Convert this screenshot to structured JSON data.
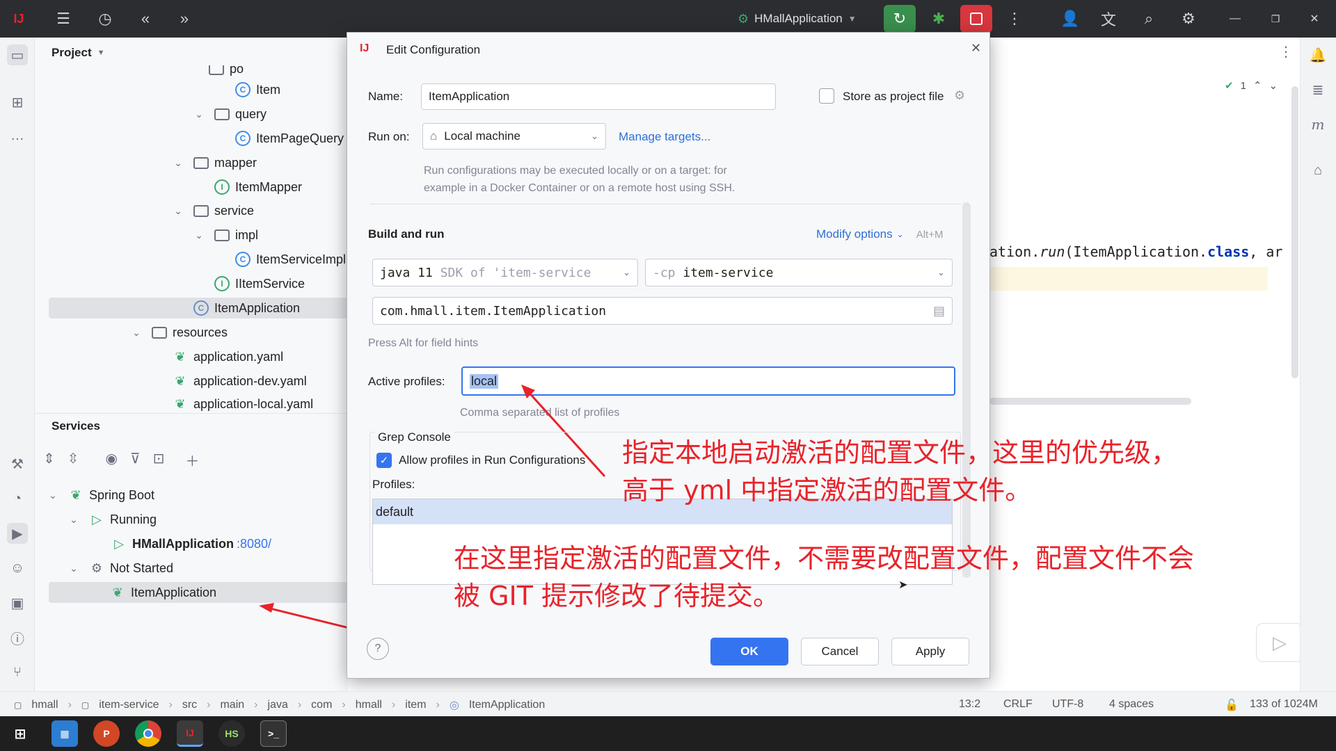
{
  "titlebar": {
    "run_config": "HMallApplication"
  },
  "project_panel": {
    "title": "Project",
    "tree": [
      {
        "label": "po",
        "kind": "folder"
      },
      {
        "label": "Item",
        "kind": "class"
      },
      {
        "label": "query",
        "kind": "folder"
      },
      {
        "label": "ItemPageQuery",
        "kind": "class"
      },
      {
        "label": "mapper",
        "kind": "folder"
      },
      {
        "label": "ItemMapper",
        "kind": "interface"
      },
      {
        "label": "service",
        "kind": "folder"
      },
      {
        "label": "impl",
        "kind": "folder"
      },
      {
        "label": "ItemServiceImpl",
        "kind": "class"
      },
      {
        "label": "IItemService",
        "kind": "interface"
      },
      {
        "label": "ItemApplication",
        "kind": "springclass"
      },
      {
        "label": "resources",
        "kind": "folder"
      },
      {
        "label": "application.yaml",
        "kind": "yaml"
      },
      {
        "label": "application-dev.yaml",
        "kind": "yaml"
      },
      {
        "label": "application-local.yaml",
        "kind": "yaml"
      }
    ]
  },
  "services_panel": {
    "title": "Services",
    "spring_boot": "Spring Boot",
    "running": "Running",
    "hmall_app": "HMallApplication",
    "hmall_port": ":8080/",
    "not_started": "Not Started",
    "item_app": "ItemApplication"
  },
  "editor": {
    "code_prefix": "ation.",
    "code_method": "run",
    "code_mid": "(ItemApplication.",
    "code_kw": "class",
    "code_tail": ", ar",
    "inspections_count": "1"
  },
  "dialog": {
    "title": "Edit Configuration",
    "name_label": "Name:",
    "name_value": "ItemApplication",
    "store_label": "Store as project file",
    "store_checked": false,
    "run_on_label": "Run on:",
    "run_on_value": "Local machine",
    "manage_targets": "Manage targets...",
    "run_on_hint_1": "Run configurations may be executed locally or on a target: for",
    "run_on_hint_2": "example in a Docker Container or on a remote host using SSH.",
    "build_run_heading": "Build and run",
    "modify_options": "Modify options",
    "modify_shortcut": "Alt+M",
    "sdk_prefix": "java 11",
    "sdk_suffix": "SDK of 'item-service",
    "cp_prefix": "-cp",
    "cp_value": "item-service",
    "main_class": "com.hmall.item.ItemApplication",
    "field_hint": "Press Alt for field hints",
    "active_profiles_label": "Active profiles:",
    "active_profiles_value": "local",
    "active_profiles_hint": "Comma separated list of profiles",
    "grep_console": "Grep Console",
    "allow_profiles": "Allow profiles in Run Configurations",
    "allow_profiles_checked": true,
    "profiles_label": "Profiles:",
    "profiles_item": "default",
    "ok": "OK",
    "cancel": "Cancel",
    "apply": "Apply"
  },
  "annotations": {
    "line1": "指定本地启动激活的配置文件，这里的优先级，",
    "line2": "高于 yml 中指定激活的配置文件。",
    "line3": "在这里指定激活的配置文件，不需要改配置文件，配置文件不会",
    "line4": "被 GIT 提示修改了待提交。"
  },
  "statusbar": {
    "breadcrumbs": [
      "hmall",
      "item-service",
      "src",
      "main",
      "java",
      "com",
      "hmall",
      "item",
      "ItemApplication"
    ],
    "position": "13:2",
    "line_sep": "CRLF",
    "encoding": "UTF-8",
    "indent": "4 spaces",
    "memory": "133 of 1024M"
  },
  "colors": {
    "accent": "#3574f0",
    "annotation": "#e8232a",
    "titlebar": "#2b2d30"
  }
}
